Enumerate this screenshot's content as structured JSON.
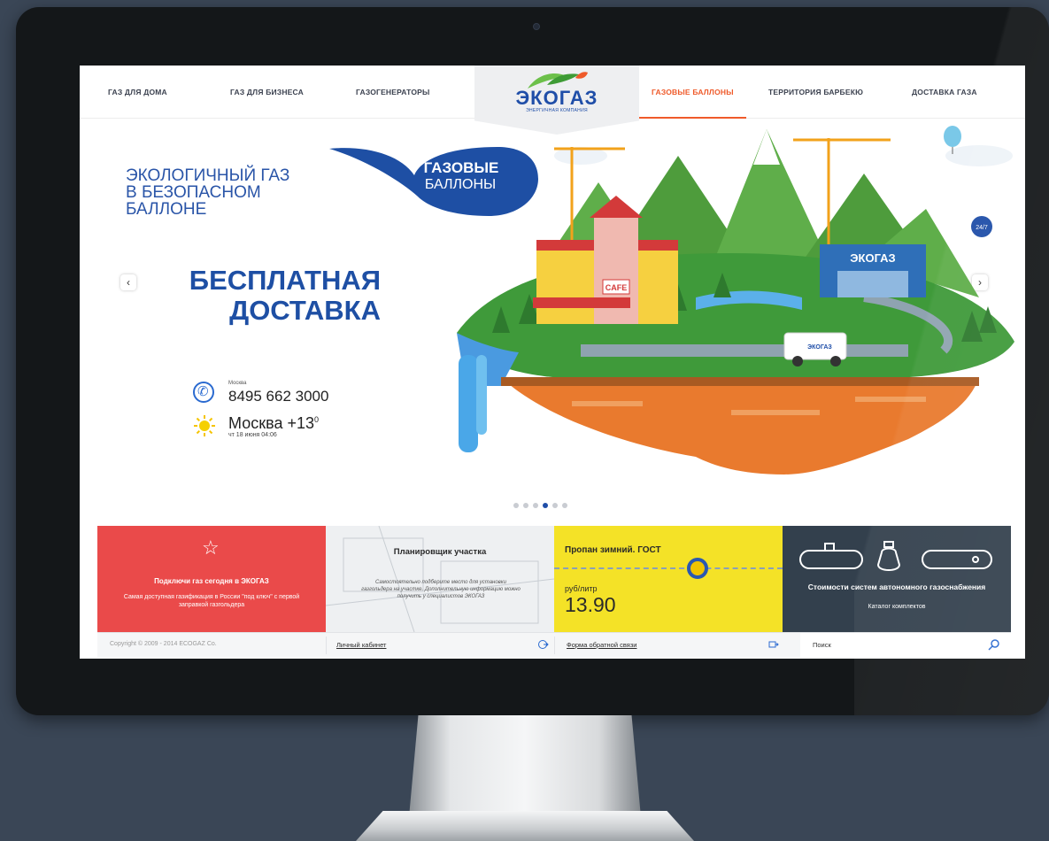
{
  "nav": {
    "items": [
      {
        "label": "ГАЗ ДЛЯ ДОМА"
      },
      {
        "label": "ГАЗ ДЛЯ БИЗНЕСА"
      },
      {
        "label": "ГАЗОГЕНЕРАТОРЫ"
      },
      {
        "label": "ГАЗОВЫЕ БАЛЛОНЫ",
        "active": true
      },
      {
        "label": "ТЕРРИТОРИЯ БАРБЕКЮ"
      },
      {
        "label": "ДОСТАВКА ГАЗА"
      }
    ]
  },
  "logo": {
    "title": "ЭКОГАЗ",
    "subtitle": "ЭНЕРГИЧНАЯ КОМПАНИЯ"
  },
  "hero": {
    "title": "ЭКОЛОГИЧНЫЙ ГАЗ\nВ БЕЗОПАСНОМ\nБАЛЛОНЕ",
    "bubble_line1": "ГАЗОВЫЕ",
    "bubble_line2": "БАЛЛОНЫ",
    "promo": "БЕСПЛАТНАЯ\nДОСТАВКА",
    "prev_glyph": "‹",
    "next_glyph": "›",
    "illustration": {
      "cafe_sign": "CAFE",
      "building_sign": "ЭКОГАЗ",
      "badge": "24/7",
      "truck_label": "ЭКОГАЗ"
    }
  },
  "contact": {
    "city": "Москва",
    "phone": "8495 662 3000",
    "weather_city_temp": "Москва +13",
    "weather_deg": "0",
    "date": "чт 18 июня 04:06"
  },
  "slider": {
    "total": 6,
    "active": 3
  },
  "tiles": {
    "connect": {
      "icon": "star-icon",
      "title": "Подключи газ сегодня в ЭКОГАЗ",
      "text": "Самая доступная газификация в России \"под ключ\" с первой заправкой газгольдера"
    },
    "planner": {
      "title": "Планировщик участка",
      "text": "Самостоятельно подберите место для установки газгольдера на участке. Дополнительную информацию можно получить у специалистов ЭКОГАЗ"
    },
    "price": {
      "title": "Пропан зимний. ГОСТ",
      "unit": "руб/литр",
      "value": "13.90"
    },
    "systems": {
      "title": "Стоимости систем автономного газоснабжения",
      "text": "Каталог комплектов"
    }
  },
  "footer": {
    "copyright": "Copyright © 2009 - 2014 ECOGAZ Co.",
    "account": "Личный кабинет",
    "feedback": "Форма обратной связи",
    "search": "Поиск"
  },
  "colors": {
    "brand_blue": "#1f4ea8",
    "accent_orange": "#ef5a2a",
    "tile_red": "#ea4a4a",
    "tile_yellow": "#f4e227",
    "tile_dark": "#33404d"
  }
}
